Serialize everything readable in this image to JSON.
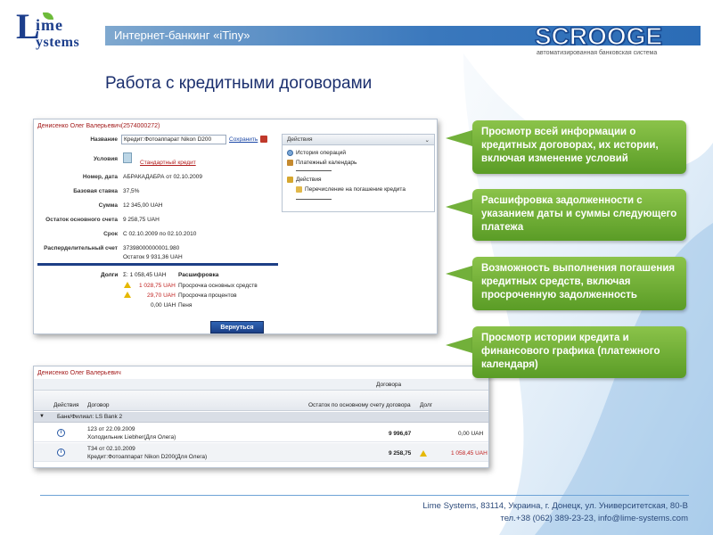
{
  "header": {
    "logo_top": "ime",
    "logo_bottom": "ystems",
    "logo_letter": "L",
    "title": "Интернет-банкинг «iTiny»",
    "brand": "SCROOGE",
    "brand_sub": "автоматизированная банковская система"
  },
  "page_title": "Работа с кредитными договорами",
  "panel1": {
    "client": "Денисенко Олег Валерьевич(2574000272)",
    "fields": [
      {
        "label": "Название",
        "value": "Кредит:Фотоаппарат Nikon D200"
      },
      {
        "label": "Условия",
        "value": "Стандартный кредит"
      },
      {
        "label": "Номер, дата",
        "value": "АБРАКАДАБРА  от  02.10.2009"
      },
      {
        "label": "Базовая ставка",
        "value": "37,5%"
      },
      {
        "label": "Сумма",
        "value": "12 345,00  UAH"
      },
      {
        "label": "Остаток основного счета",
        "value": "9 258,75  UAH"
      },
      {
        "label": "Срок",
        "value": "С 02.10.2009  по 02.10.2010"
      },
      {
        "label": "Расперделительный счет",
        "value": "37398000000001.980"
      }
    ],
    "save_link": "Сохранить",
    "balance_line": "Остаток 9 931,36 UAH",
    "debts_label": "Долги",
    "debts_total": "Σ:  1 058,45 UAH",
    "decode_label": "Расшифровка",
    "debts": [
      {
        "amount": "1 028,75 UAH",
        "desc": "Просрочка основных средств",
        "warn": true,
        "color": "#c0201f"
      },
      {
        "amount": "29,70 UAH",
        "desc": "Просрочка процентов",
        "warn": true,
        "color": "#c0201f"
      },
      {
        "amount": "0,00 UAH",
        "desc": "Пеня",
        "warn": false,
        "color": "#222222"
      }
    ],
    "actions": {
      "title": "Действия",
      "items": [
        "История операций",
        "Платежный календарь"
      ],
      "group": "Действия",
      "sub_items": [
        "Перечисление на погашение кредита"
      ]
    },
    "back_button": "Вернуться"
  },
  "panel2": {
    "client": "Денисенко Олег Валерьевич",
    "topbar_label": "Договора",
    "columns": [
      "Действия",
      "Договор",
      "Остаток по основному счету договора",
      "Долг"
    ],
    "group": "Банк/Филиал: LS Bank 2",
    "rows": [
      {
        "line1": "123 от 22.09.2009",
        "line2": "Холодильник Liebher(Для Олега)",
        "balance": "9 996,67",
        "debt": "0,00 UAH",
        "warn": false
      },
      {
        "line1": "Т34 от 02.10.2009",
        "line2": "Кредит:Фотоаппарат Nikon D200(Для Олега)",
        "balance": "9 258,75",
        "debt": "1 058,45 UAH",
        "warn": true
      }
    ]
  },
  "callouts": [
    "Просмотр всей информации о кредитных договорах, их истории, включая изменение условий",
    "Расшифровка задолженности с указанием даты и суммы следующего платежа",
    "Возможность выполнения погашения кредитных средств, включая просроченную задолженность",
    "Просмотр истории кредита и финансового графика (платежного календаря)"
  ],
  "footer": {
    "line1": "Lime Systems, 83114, Украина, г. Донецк, ул. Университетская, 80-В",
    "line2": "тел.+38 (062) 389-23-23, info@lime-systems.com"
  },
  "colors": {
    "accent": "#2b6cb6",
    "callout": "#6aa832",
    "title": "#1b2f6e"
  }
}
